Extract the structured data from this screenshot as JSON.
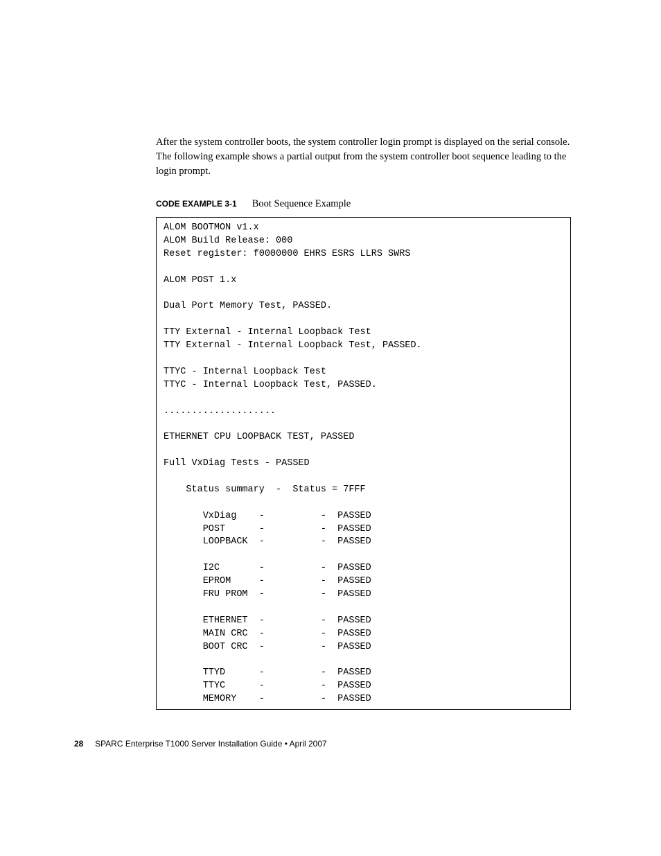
{
  "intro": "After the system controller boots, the system controller login prompt is displayed on the serial console. The following example shows a partial output from the system controller boot sequence leading to the login prompt.",
  "caption": {
    "label": "CODE EXAMPLE 3-1",
    "title": "Boot Sequence Example"
  },
  "code": "ALOM BOOTMON v1.x\nALOM Build Release: 000\nReset register: f0000000 EHRS ESRS LLRS SWRS\n\nALOM POST 1.x\n\nDual Port Memory Test, PASSED.\n\nTTY External - Internal Loopback Test\nTTY External - Internal Loopback Test, PASSED.\n\nTTYC - Internal Loopback Test\nTTYC - Internal Loopback Test, PASSED.\n\n....................\n\nETHERNET CPU LOOPBACK TEST, PASSED\n\nFull VxDiag Tests - PASSED\n\n    Status summary  -  Status = 7FFF\n\n       VxDiag    -          -  PASSED\n       POST      -          -  PASSED\n       LOOPBACK  -          -  PASSED\n\n       I2C       -          -  PASSED\n       EPROM     -          -  PASSED\n       FRU PROM  -          -  PASSED\n\n       ETHERNET  -          -  PASSED\n       MAIN CRC  -          -  PASSED\n       BOOT CRC  -          -  PASSED\n\n       TTYD      -          -  PASSED\n       TTYC      -          -  PASSED\n       MEMORY    -          -  PASSED",
  "footer": {
    "page_number": "28",
    "text": "SPARC Enterprise T1000 Server Installation Guide • April 2007"
  }
}
